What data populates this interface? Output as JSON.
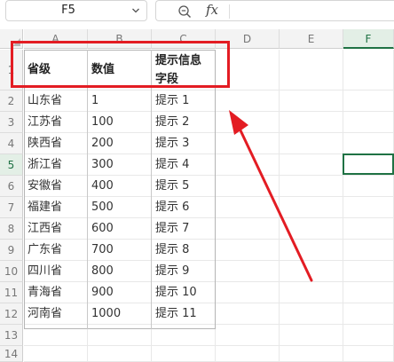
{
  "formula_bar": {
    "name_box": "F5",
    "fx_label": "fx",
    "formula": ""
  },
  "grid": {
    "columns": [
      "A",
      "B",
      "C",
      "D",
      "E",
      "F"
    ],
    "rows": [
      "1",
      "2",
      "3",
      "4",
      "5",
      "6",
      "7",
      "8",
      "9",
      "10",
      "11",
      "12",
      "13",
      "14"
    ],
    "active_column": "F",
    "active_row": "5",
    "header": {
      "col_a": "省级",
      "col_b": "数值",
      "col_c_line1": "提示信息",
      "col_c_line2": "字段"
    },
    "data": [
      [
        "山东省",
        "1",
        "提示 1"
      ],
      [
        "江苏省",
        "100",
        "提示 2"
      ],
      [
        "陕西省",
        "200",
        "提示 3"
      ],
      [
        "浙江省",
        "300",
        "提示 4"
      ],
      [
        "安徽省",
        "400",
        "提示 5"
      ],
      [
        "福建省",
        "500",
        "提示 6"
      ],
      [
        "江西省",
        "600",
        "提示 7"
      ],
      [
        "广东省",
        "700",
        "提示 8"
      ],
      [
        "四川省",
        "800",
        "提示 9"
      ],
      [
        "青海省",
        "900",
        "提示 10"
      ],
      [
        "河南省",
        "1000",
        "提示 11"
      ]
    ]
  },
  "annotation": {
    "box_color": "#e31c23",
    "arrow_color": "#e31c23"
  },
  "colors": {
    "selection": "#1f7244"
  }
}
